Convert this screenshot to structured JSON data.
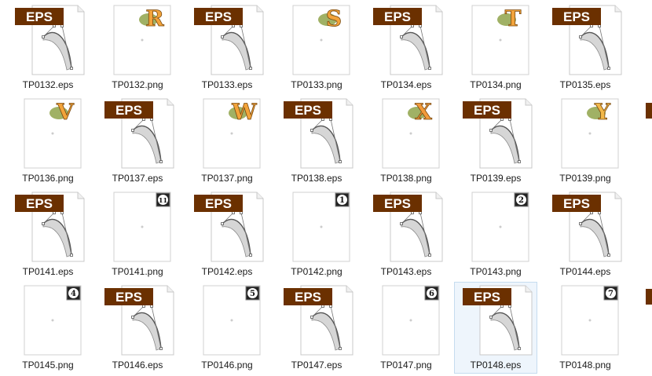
{
  "files": [
    {
      "name": "TP0132.eps",
      "kind": "eps"
    },
    {
      "name": "TP0132.png",
      "kind": "png",
      "art": "letter",
      "letter": "R",
      "color": "#f2a33a"
    },
    {
      "name": "TP0133.eps",
      "kind": "eps"
    },
    {
      "name": "TP0133.png",
      "kind": "png",
      "art": "letter",
      "letter": "S",
      "color": "#f2a33a"
    },
    {
      "name": "TP0134.eps",
      "kind": "eps"
    },
    {
      "name": "TP0134.png",
      "kind": "png",
      "art": "letter",
      "letter": "T",
      "color": "#f2a33a"
    },
    {
      "name": "TP0135.eps",
      "kind": "eps"
    },
    {
      "name": "TP0136.png",
      "kind": "png",
      "art": "letter",
      "letter": "V",
      "color": "#f2a33a"
    },
    {
      "name": "TP0137.eps",
      "kind": "eps"
    },
    {
      "name": "TP0137.png",
      "kind": "png",
      "art": "letter",
      "letter": "W",
      "color": "#f2a33a"
    },
    {
      "name": "TP0138.eps",
      "kind": "eps"
    },
    {
      "name": "TP0138.png",
      "kind": "png",
      "art": "letter",
      "letter": "X",
      "color": "#f29a3a"
    },
    {
      "name": "TP0139.eps",
      "kind": "eps"
    },
    {
      "name": "TP0139.png",
      "kind": "png",
      "art": "letter",
      "letter": "Y",
      "color": "#f2b84a"
    },
    {
      "name": "TP0141.eps",
      "kind": "eps"
    },
    {
      "name": "TP0141.png",
      "kind": "png",
      "art": "number",
      "numeral": "11"
    },
    {
      "name": "TP0142.eps",
      "kind": "eps"
    },
    {
      "name": "TP0142.png",
      "kind": "png",
      "art": "number",
      "numeral": "1"
    },
    {
      "name": "TP0143.eps",
      "kind": "eps"
    },
    {
      "name": "TP0143.png",
      "kind": "png",
      "art": "number",
      "numeral": "2"
    },
    {
      "name": "TP0144.eps",
      "kind": "eps"
    },
    {
      "name": "TP0145.png",
      "kind": "png",
      "art": "number",
      "numeral": "4"
    },
    {
      "name": "TP0146.eps",
      "kind": "eps"
    },
    {
      "name": "TP0146.png",
      "kind": "png",
      "art": "number",
      "numeral": "5"
    },
    {
      "name": "TP0147.eps",
      "kind": "eps"
    },
    {
      "name": "TP0147.png",
      "kind": "png",
      "art": "number",
      "numeral": "6"
    },
    {
      "name": "TP0148.eps",
      "kind": "eps",
      "selected": true
    },
    {
      "name": "TP0148.png",
      "kind": "png",
      "art": "number",
      "numeral": "7"
    }
  ],
  "eps_badge_text": "EPS",
  "colors": {
    "eps_badge": "#6b3000",
    "eps_badge_text": "#ffffff",
    "page_border": "#c8c8c8",
    "selection_bg": "#eef5fc",
    "selection_border": "#c5dcef"
  },
  "icons": {
    "eps": "eps-file-icon",
    "png": "png-image-thumbnail"
  }
}
